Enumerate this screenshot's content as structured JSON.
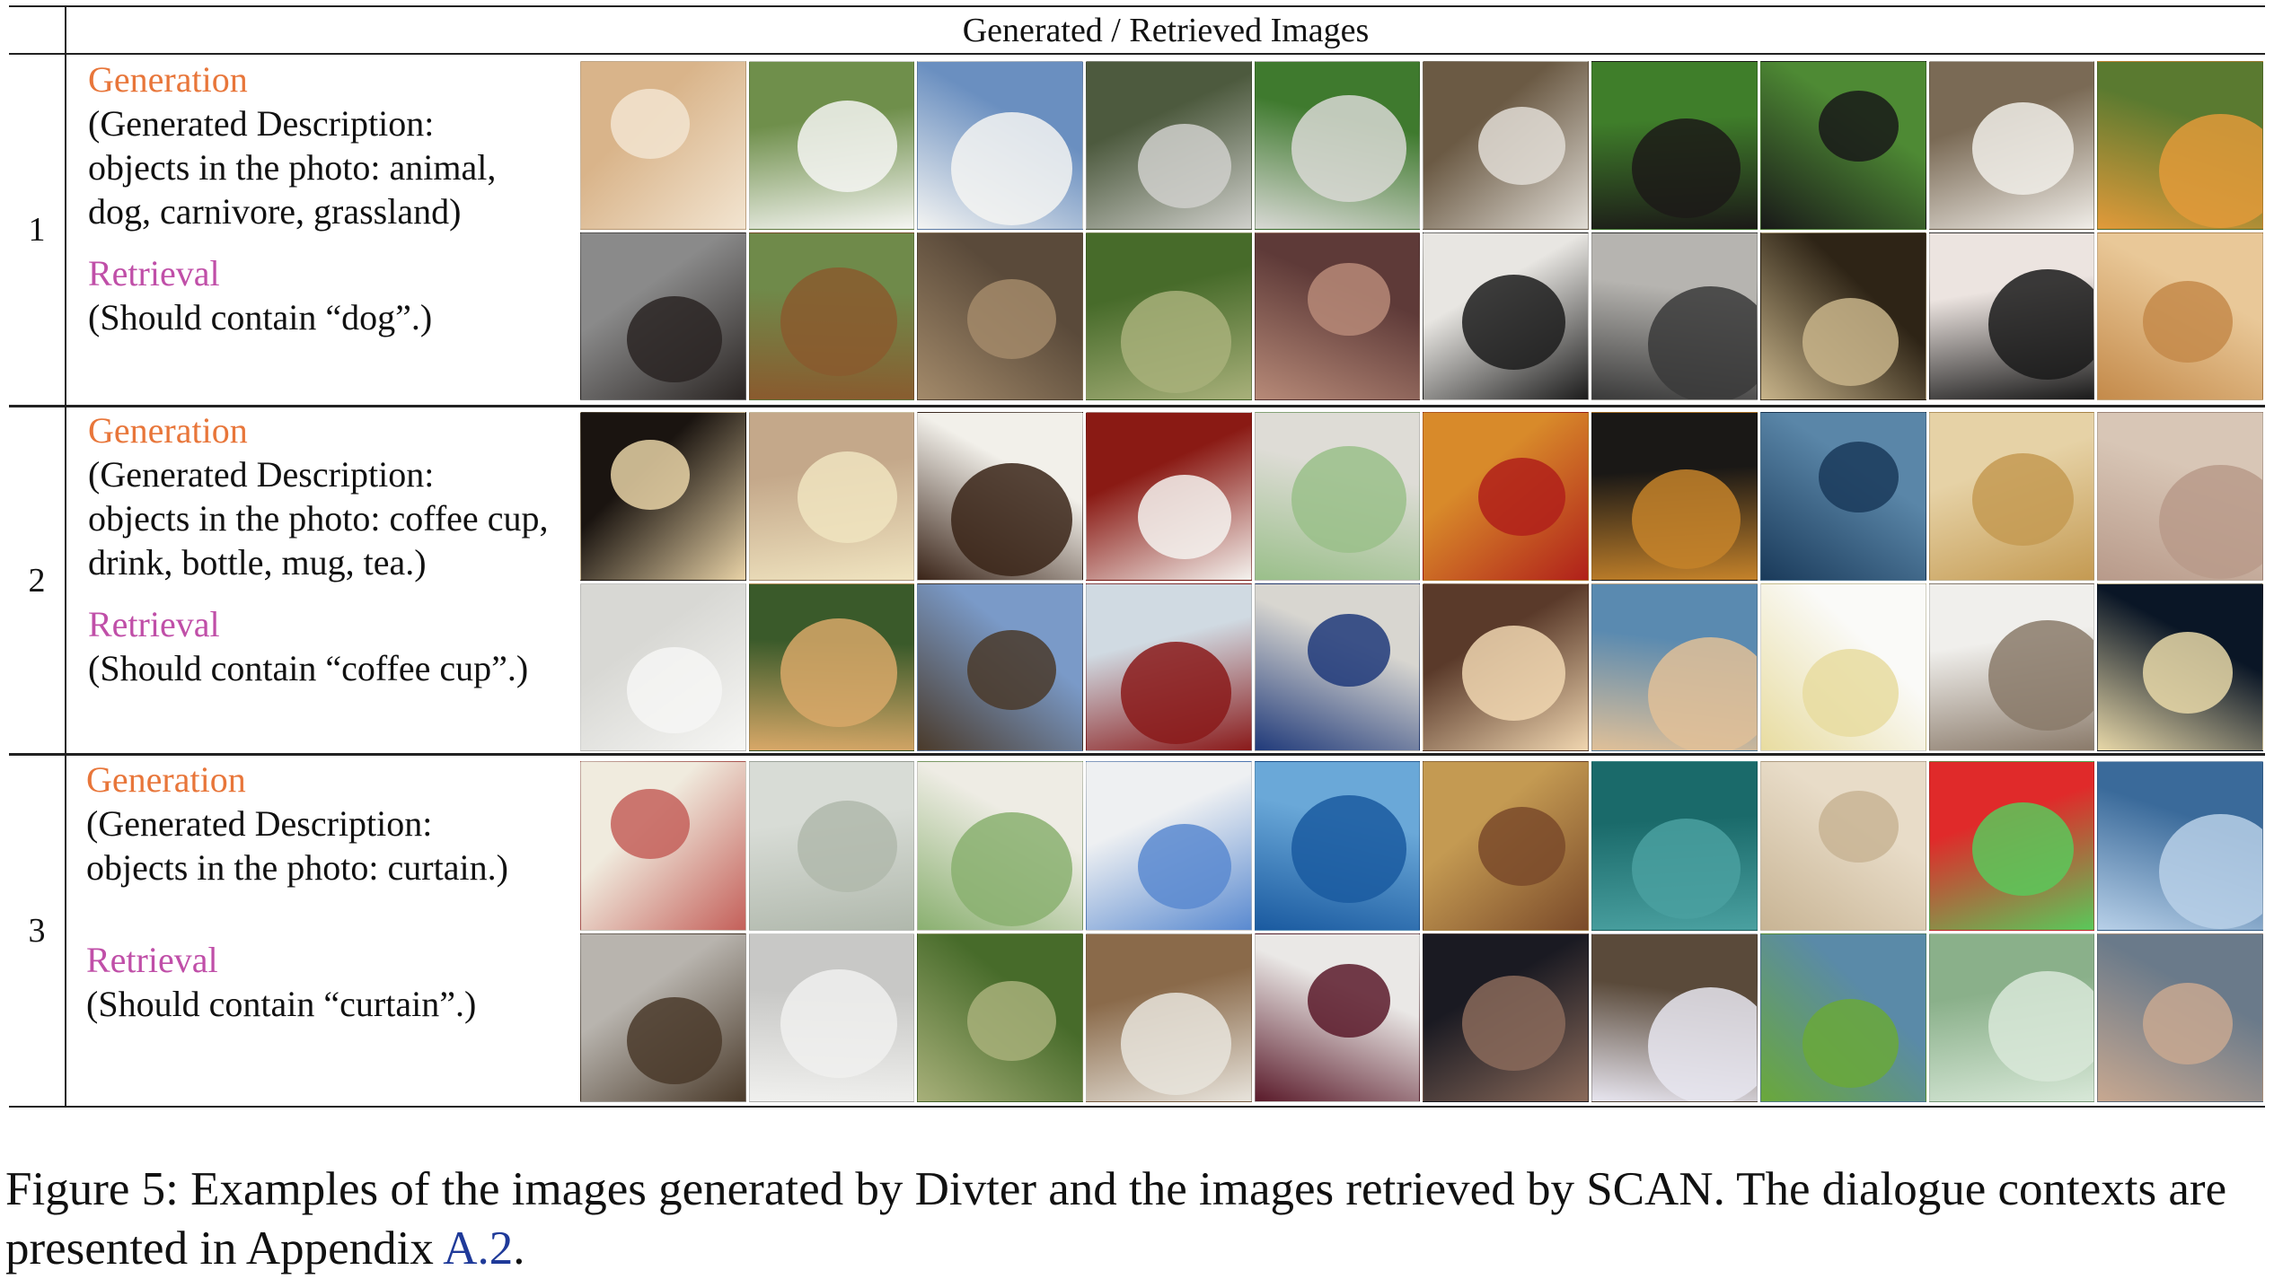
{
  "table": {
    "header": "Generated / Retrieved Images",
    "rows": [
      {
        "num": "1",
        "gen_label": "Generation",
        "gen_lines": [
          "(Generated Description:",
          "objects in the photo: animal,",
          "dog, carnivore, grassland)"
        ],
        "ret_label": "Retrieval",
        "ret_lines": [
          "(Should contain “dog”.)"
        ],
        "generated_images": [
          {
            "icon": "pomeranian-puppy",
            "colors": [
              "#d9b48a",
              "#f2e4d0"
            ]
          },
          {
            "icon": "samoyed-dog",
            "colors": [
              "#6f8f4b",
              "#f5f5f2"
            ]
          },
          {
            "icon": "samoyed-dog",
            "colors": [
              "#6a8fc0",
              "#f4f4f2"
            ]
          },
          {
            "icon": "husky-dog",
            "colors": [
              "#4d5a3e",
              "#cfcfcb"
            ]
          },
          {
            "icon": "husky-dog",
            "colors": [
              "#3f7a2e",
              "#d8d8d4"
            ]
          },
          {
            "icon": "husky-dog",
            "colors": [
              "#6b5a44",
              "#e0dcd5"
            ]
          },
          {
            "icon": "bernese-dog",
            "colors": [
              "#3f7e2a",
              "#1c1a18"
            ]
          },
          {
            "icon": "black-puppy",
            "colors": [
              "#4e8a34",
              "#191919"
            ]
          },
          {
            "icon": "beagle-dog",
            "colors": [
              "#7a6a55",
              "#f0ede8"
            ]
          },
          {
            "icon": "pomeranian-puppy",
            "colors": [
              "#5a7a30",
              "#e29a3a"
            ]
          }
        ],
        "retrieved_images": [
          {
            "icon": "pug-dog",
            "colors": [
              "#8a8a8a",
              "#2a2523"
            ]
          },
          {
            "icon": "german-shepherd-dog",
            "colors": [
              "#6f8a4a",
              "#8a5a2e"
            ]
          },
          {
            "icon": "tabby-cat",
            "colors": [
              "#5a4a3a",
              "#a38a6a"
            ]
          },
          {
            "icon": "grass-plant",
            "colors": [
              "#476b2a",
              "#a8b07a"
            ]
          },
          {
            "icon": "people-crowd",
            "colors": [
              "#5e3a38",
              "#b78a78"
            ]
          },
          {
            "icon": "leather-jacket",
            "colors": [
              "#e8e6e2",
              "#1c1c1c"
            ]
          },
          {
            "icon": "people-cafe",
            "colors": [
              "#b6b4b0",
              "#3a3a3a"
            ]
          },
          {
            "icon": "compass-dial",
            "colors": [
              "#2e2416",
              "#c8b48a"
            ]
          },
          {
            "icon": "cat-drawing",
            "colors": [
              "#ece4e0",
              "#1a1a1a"
            ]
          },
          {
            "icon": "cake-slice",
            "colors": [
              "#e9c898",
              "#c48a4a"
            ]
          }
        ]
      },
      {
        "num": "2",
        "gen_label": "Generation",
        "gen_lines": [
          "(Generated Description:",
          "objects in the photo: coffee cup,",
          "drink, bottle, mug, tea.)"
        ],
        "ret_label": "Retrieval",
        "ret_lines": [
          "(Should contain “coffee cup”.)"
        ],
        "generated_images": [
          {
            "icon": "coffee-cup",
            "colors": [
              "#1a1410",
              "#e8d2a6"
            ]
          },
          {
            "icon": "tea-cup",
            "colors": [
              "#c4a88a",
              "#f0e4c0"
            ]
          },
          {
            "icon": "coffee-cup",
            "colors": [
              "#f2f0ea",
              "#3a2418"
            ]
          },
          {
            "icon": "coffee-mug",
            "colors": [
              "#8a1a14",
              "#f4f2ee"
            ]
          },
          {
            "icon": "striped-cup",
            "colors": [
              "#dedcd6",
              "#9abf8a"
            ]
          },
          {
            "icon": "red-mugs",
            "colors": [
              "#d88a2a",
              "#b0201a"
            ]
          },
          {
            "icon": "coffee-mug",
            "colors": [
              "#1a1816",
              "#c4822a"
            ]
          },
          {
            "icon": "coffee-mug",
            "colors": [
              "#5a86a8",
              "#1a3a5a"
            ]
          },
          {
            "icon": "coffee-cup",
            "colors": [
              "#e6d2a6",
              "#c49a52"
            ]
          },
          {
            "icon": "cocoa-mug",
            "colors": [
              "#d8c6b6",
              "#b89a8a"
            ]
          }
        ],
        "retrieved_images": [
          {
            "icon": "milk-glass",
            "colors": [
              "#d8d8d4",
              "#f6f6f4"
            ]
          },
          {
            "icon": "tea-cup",
            "colors": [
              "#3a5a2a",
              "#d8a868"
            ]
          },
          {
            "icon": "coffee-grinder",
            "colors": [
              "#7a9ac8",
              "#4a3a2a"
            ]
          },
          {
            "icon": "wine-glass",
            "colors": [
              "#d0dae2",
              "#8a1a1a"
            ]
          },
          {
            "icon": "coffee-cup",
            "colors": [
              "#d8d6d0",
              "#203a7a"
            ]
          },
          {
            "icon": "cake",
            "colors": [
              "#5a3a2a",
              "#f0d6b0"
            ]
          },
          {
            "icon": "fennec-fox",
            "colors": [
              "#5a8ab0",
              "#e0c098"
            ]
          },
          {
            "icon": "wafer-snack",
            "colors": [
              "#fafaf8",
              "#e8dca0"
            ]
          },
          {
            "icon": "insect-bug",
            "colors": [
              "#f0efec",
              "#8a7a6a"
            ]
          },
          {
            "icon": "snack-crackers",
            "colors": [
              "#0a1626",
              "#e8d8a8"
            ]
          }
        ]
      },
      {
        "num": "3",
        "gen_label": "Generation",
        "gen_lines": [
          "(Generated Description:",
          "objects in the photo: curtain.)"
        ],
        "ret_label": "Retrieval",
        "ret_lines": [
          "(Should contain “curtain”.)"
        ],
        "generated_images": [
          {
            "icon": "floral-curtain",
            "colors": [
              "#f0ebde",
              "#c4605a"
            ]
          },
          {
            "icon": "sheer-curtain",
            "colors": [
              "#d8dcd6",
              "#b0b8ac"
            ]
          },
          {
            "icon": "patterned-curtain",
            "colors": [
              "#eeece4",
              "#8ab070"
            ]
          },
          {
            "icon": "square-pattern-curtain",
            "colors": [
              "#eef0f2",
              "#5a8ad0"
            ]
          },
          {
            "icon": "ring-pattern-curtain",
            "colors": [
              "#6aa8d8",
              "#1a5aa0"
            ]
          },
          {
            "icon": "plaid-curtain",
            "colors": [
              "#c49a52",
              "#7a4a2a"
            ]
          },
          {
            "icon": "teal-curtain",
            "colors": [
              "#1a6a6a",
              "#4aa0a0"
            ]
          },
          {
            "icon": "beige-curtain",
            "colors": [
              "#e8dcc8",
              "#c8b494"
            ]
          },
          {
            "icon": "dotted-curtain",
            "colors": [
              "#e02a2a",
              "#5ac85a"
            ]
          },
          {
            "icon": "blue-curtain",
            "colors": [
              "#3a6a9a",
              "#b8d0e8"
            ]
          }
        ],
        "retrieved_images": [
          {
            "icon": "frog",
            "colors": [
              "#b8b4ae",
              "#4a3a2a"
            ]
          },
          {
            "icon": "keyboard",
            "colors": [
              "#c8c8c6",
              "#f0f0ee"
            ]
          },
          {
            "icon": "grass-plant",
            "colors": [
              "#476b2a",
              "#a8b07a"
            ]
          },
          {
            "icon": "horse-rider",
            "colors": [
              "#8a6a4a",
              "#e8e4dc"
            ]
          },
          {
            "icon": "high-heel-shoe",
            "colors": [
              "#eae8e6",
              "#5a1a2a"
            ]
          },
          {
            "icon": "people-night",
            "colors": [
              "#1a1a22",
              "#8a6a5a"
            ]
          },
          {
            "icon": "mug-blue-star",
            "colors": [
              "#5a4a3a",
              "#e8e6f0"
            ]
          },
          {
            "icon": "edamame-bowl",
            "colors": [
              "#5a8aa8",
              "#6aa83a"
            ]
          },
          {
            "icon": "grass-insect",
            "colors": [
              "#8ab08a",
              "#d8e8d8"
            ]
          },
          {
            "icon": "people-crowd",
            "colors": [
              "#6a7a8a",
              "#c8a890"
            ]
          }
        ]
      }
    ]
  },
  "caption": {
    "main": "Figure 5: Examples of the images generated by Divter and the images retrieved by SCAN. The dialogue contexts are presented in Appendix ",
    "ref": "A.2",
    "end": "."
  }
}
